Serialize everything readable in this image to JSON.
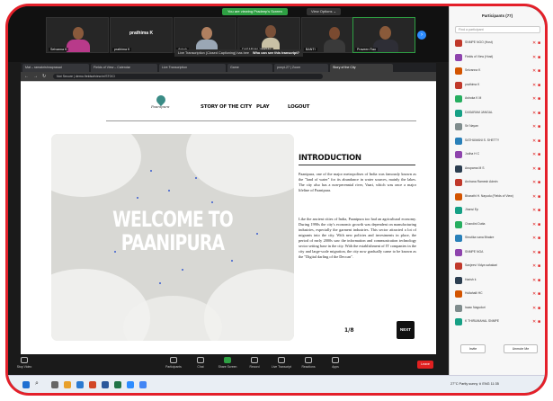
{
  "zoom": {
    "share_banner": "You are viewing Pradeep's Screen",
    "view_options": "View Options ⌄",
    "gallery": [
      {
        "name": "Selvanna K"
      },
      {
        "name": "prathima K",
        "label": "prathima K"
      },
      {
        "name": "Ashok"
      },
      {
        "name": "DASARAM JANGAL",
        "label": "DASARAM JANGAL"
      },
      {
        "name": "BANTI"
      },
      {
        "name": "Praveen Rao"
      }
    ],
    "transcript_toast": "Live Transcription (Closed Captioning) has been enabled",
    "transcript_question": "Who can see this transcript?",
    "controls": [
      "Stop Video",
      "Participants",
      "Chat",
      "Share Screen",
      "Record",
      "Live Transcript",
      "Reactions",
      "Apps"
    ],
    "end_label": "Leave"
  },
  "browser": {
    "tabs": [
      "Mat – ramakrishnaprasad",
      "Fields of View – Calendar",
      "Live Transcription",
      "Game",
      "ponyt-27 | Zoom",
      "Story of the City"
    ],
    "url": "Not Secure  |  demo.fieldsofview.in/STOC/",
    "nav_icons": [
      "back-icon",
      "forward-icon",
      "reload-icon"
    ]
  },
  "site": {
    "logo_text": "Paanipura",
    "nav": [
      "STORY OF THE CITY",
      "PLAY",
      "LOGOUT"
    ],
    "hero_title_line1": "WELCOME TO",
    "hero_title_line2": "PAANIPURA",
    "intro_title": "INTRODUCTION",
    "intro_p1": "Paanipura, one of the major metropolises of India was famously known as the \"land of water\" for its abundance in water sources, mainly the lakes. The city also has a non-perennial river, Vaari, which was once a major lifeline of Paanipura.",
    "intro_p2": "Like the ancient cities of India, Paanipura too had an agricultural economy. During 1990s the city's economic growth was dependent on manufacturing industries, especially the garment industries. This sector attracted a lot of migrants into the city. With new policies and investments in place, the period of early 2000s saw the information and communication technology sector setting base in the city. With the establishment of IT companies in the city and large-scale migration, the city now gradually came to be known as the \"Digital darling of the Deccan\".",
    "pager": "1/8",
    "next_label": "NEXT"
  },
  "participants": {
    "title": "Participants (77)",
    "search_placeholder": "Find a participant",
    "list": [
      {
        "name": "SNMPE NGO (Host)",
        "color": "#c0392b"
      },
      {
        "name": "Fields of View (Host)",
        "color": "#8e44ad"
      },
      {
        "name": "Selvanna K",
        "color": "#d35400"
      },
      {
        "name": "prathima K",
        "color": "#c0392b"
      },
      {
        "name": "Ashoka K M",
        "color": "#27ae60"
      },
      {
        "name": "DASARAM JANGAL",
        "color": "#16a085"
      },
      {
        "name": "Sri Nayan",
        "color": "#7f8c8d"
      },
      {
        "name": "SATHUMANI S. SHETTY",
        "color": "#2980b9"
      },
      {
        "name": "Jodha H C",
        "color": "#8e44ad"
      },
      {
        "name": "Anupama M S",
        "color": "#2c3e50"
      },
      {
        "name": "Archana Ramesh Admin",
        "color": "#c0392b"
      },
      {
        "name": "Bharathi H. Nayudu (Fields of View)",
        "color": "#d35400"
      },
      {
        "name": "Jhansi Ep",
        "color": "#16a085"
      },
      {
        "name": "Chandini Dutta",
        "color": "#27ae60"
      },
      {
        "name": "Shrutika vana Bhakre",
        "color": "#2980b9"
      },
      {
        "name": "SNMPE NGA",
        "color": "#8e44ad"
      },
      {
        "name": "Sanjeevi Vidya sahakari",
        "color": "#c0392b"
      },
      {
        "name": "Harish k",
        "color": "#2c3e50"
      },
      {
        "name": "Hullahalli HC",
        "color": "#d35400"
      },
      {
        "name": "Isaac Naguduri",
        "color": "#7f8c8d"
      },
      {
        "name": "K THIRUMAHAL SNMPE",
        "color": "#16a085"
      }
    ],
    "invite_label": "Invite",
    "unmute_label": "Unmute Me"
  },
  "taskbar": {
    "time": "27°C  Partly sunny  ∧  ENG  11:35"
  }
}
